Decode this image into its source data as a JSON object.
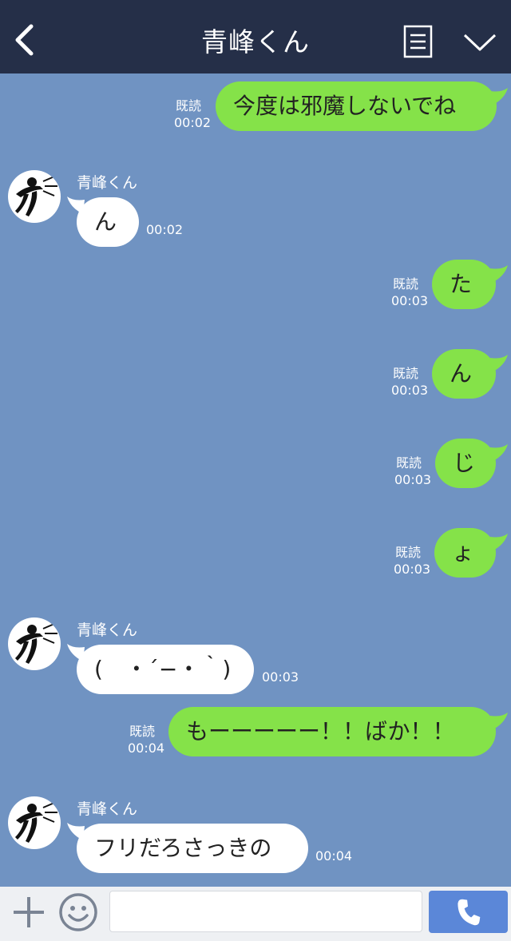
{
  "header": {
    "title": "青峰くん",
    "back_icon": "chevron-left-icon",
    "menu_icon": "list-menu-icon",
    "collapse_icon": "chevron-down-icon"
  },
  "messages": [
    {
      "dir": "out",
      "text": "今度は邪魔しないでね",
      "read": "既読",
      "time": "00:02"
    },
    {
      "dir": "in",
      "sender": "青峰くん",
      "text": "ん",
      "time": "00:02"
    },
    {
      "dir": "out",
      "text": "た",
      "read": "既読",
      "time": "00:03"
    },
    {
      "dir": "out",
      "text": "ん",
      "read": "既読",
      "time": "00:03"
    },
    {
      "dir": "out",
      "text": "じ",
      "read": "既読",
      "time": "00:03"
    },
    {
      "dir": "out",
      "text": "ょ",
      "read": "既読",
      "time": "00:03"
    },
    {
      "dir": "in",
      "sender": "青峰くん",
      "text": "(　・´−・｀)",
      "time": "00:03"
    },
    {
      "dir": "out",
      "text": "もーーーーー！！ばか！！",
      "read": "既読",
      "time": "00:04"
    },
    {
      "dir": "in",
      "sender": "青峰くん",
      "text": "フリだろさっきの",
      "time": "00:04"
    }
  ],
  "footer": {
    "input_placeholder": "",
    "plus_icon": "plus-icon",
    "emoji_icon": "smiley-icon",
    "call_icon": "phone-icon"
  },
  "colors": {
    "header_bg": "#252f48",
    "chat_bg": "#7093c2",
    "outgoing_bubble": "#85e249",
    "incoming_bubble": "#ffffff",
    "call_button": "#5b87d8"
  }
}
